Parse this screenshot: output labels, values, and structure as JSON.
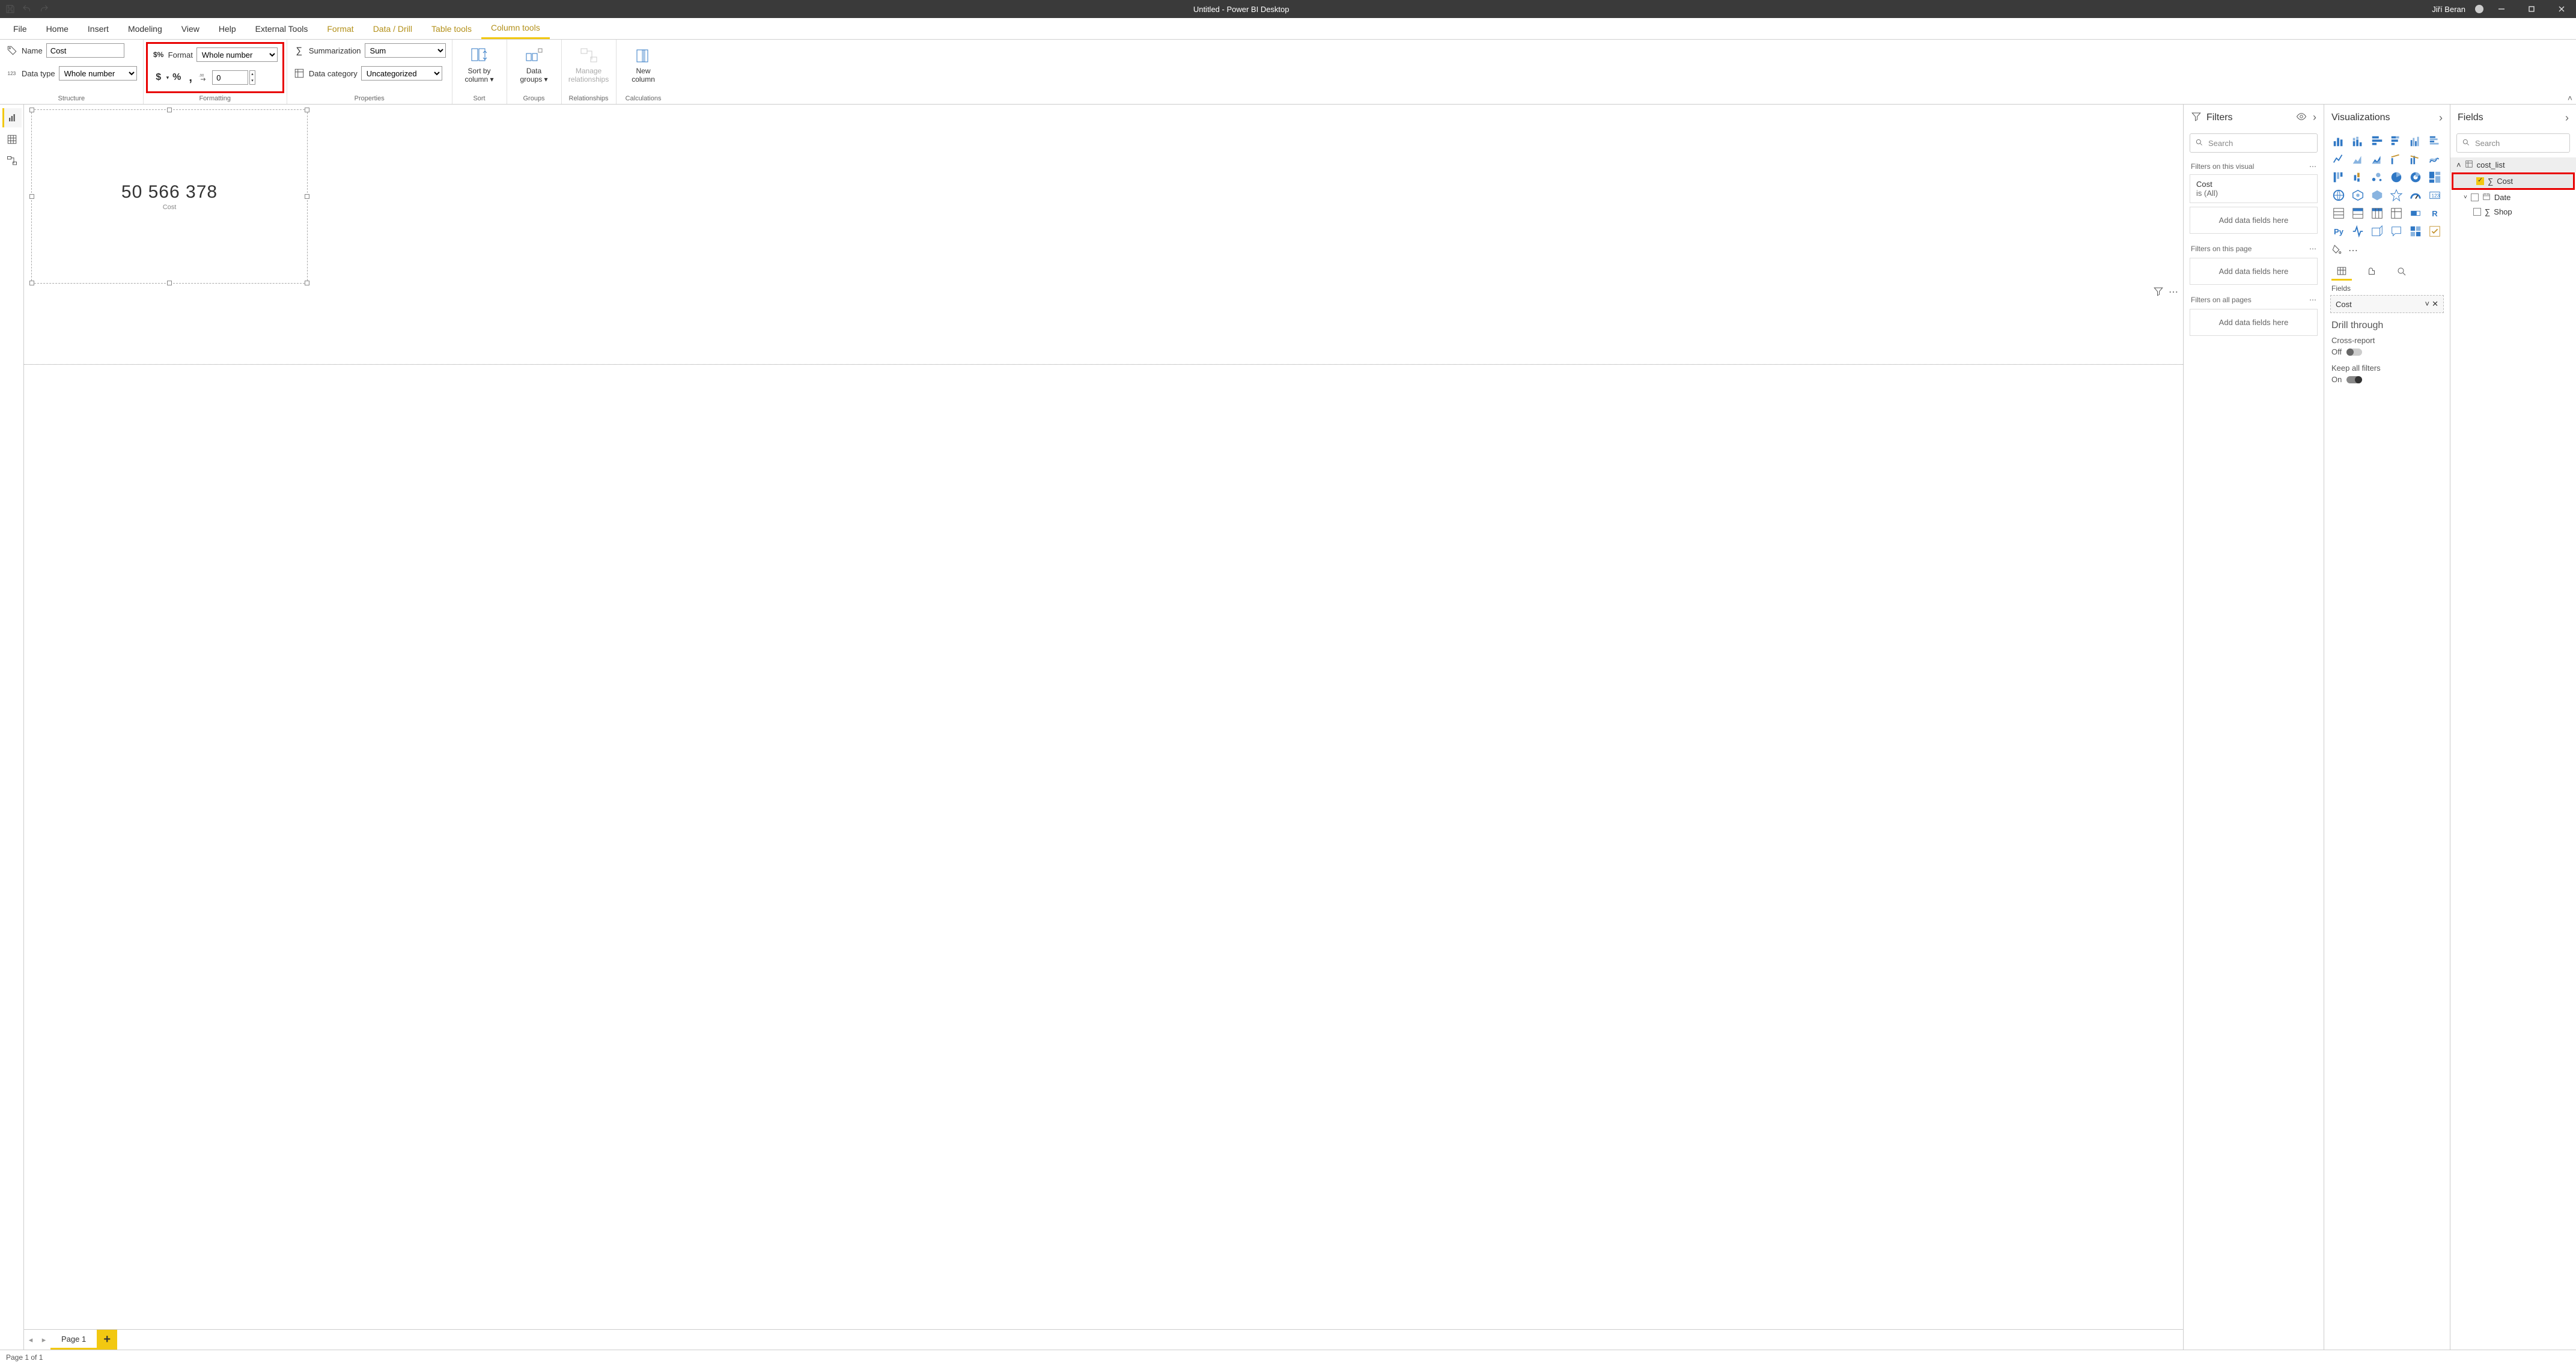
{
  "titlebar": {
    "title": "Untitled - Power BI Desktop",
    "user": "Jiří Beran"
  },
  "tabs": {
    "file": "File",
    "items": [
      "Home",
      "Insert",
      "Modeling",
      "View",
      "Help",
      "External Tools",
      "Format",
      "Data / Drill",
      "Table tools",
      "Column tools"
    ],
    "highlight_from": 6,
    "active_index": 9
  },
  "ribbon": {
    "structure": {
      "name_label": "Name",
      "name_value": "Cost",
      "datatype_label": "Data type",
      "datatype_value": "Whole number",
      "group_label": "Structure"
    },
    "formatting": {
      "format_label": "Format",
      "format_value": "Whole number",
      "decimal_value": "0",
      "group_label": "Formatting"
    },
    "properties": {
      "summarization_label": "Summarization",
      "summarization_value": "Sum",
      "category_label": "Data category",
      "category_value": "Uncategorized",
      "group_label": "Properties"
    },
    "sort": {
      "label1": "Sort by",
      "label2": "column",
      "group_label": "Sort"
    },
    "groups": {
      "label1": "Data",
      "label2": "groups",
      "group_label": "Groups"
    },
    "relationships": {
      "label1": "Manage",
      "label2": "relationships",
      "group_label": "Relationships"
    },
    "calculations": {
      "label1": "New",
      "label2": "column",
      "group_label": "Calculations"
    }
  },
  "canvas": {
    "card_value": "50 566 378",
    "card_label": "Cost",
    "page_tab": "Page 1"
  },
  "filters": {
    "header": "Filters",
    "search_placeholder": "Search",
    "on_visual": "Filters on this visual",
    "filter_field": "Cost",
    "filter_state": "is (All)",
    "add_fields": "Add data fields here",
    "on_page": "Filters on this page",
    "on_all": "Filters on all pages"
  },
  "viz": {
    "header": "Visualizations",
    "fields_label": "Fields",
    "well_value": "Cost",
    "drill_title": "Drill through",
    "cross_report": "Cross-report",
    "off": "Off",
    "keep_filters": "Keep all filters",
    "on": "On"
  },
  "fields": {
    "header": "Fields",
    "search_placeholder": "Search",
    "table": "cost_list",
    "items": [
      {
        "name": "Cost",
        "checked": true,
        "sigma": true,
        "highlighted": true
      },
      {
        "name": "Date",
        "checked": false,
        "sigma": false,
        "date": true
      },
      {
        "name": "Shop",
        "checked": false,
        "sigma": true
      }
    ]
  },
  "statusbar": {
    "text": "Page 1 of 1"
  }
}
